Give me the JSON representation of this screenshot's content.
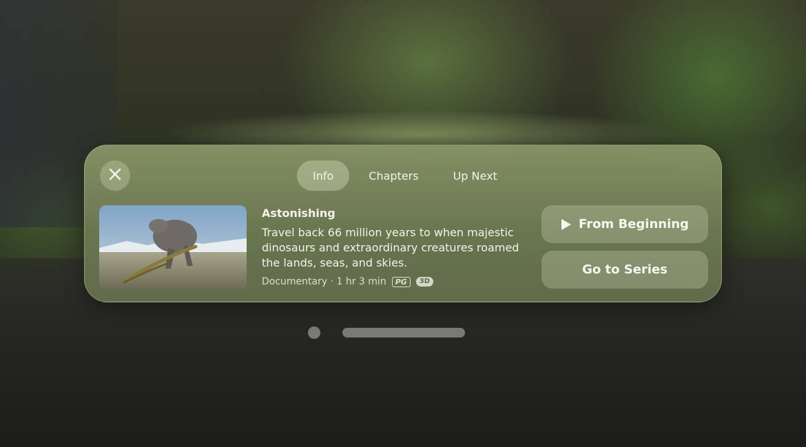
{
  "panel": {
    "tabs": [
      {
        "label": "Info",
        "active": true
      },
      {
        "label": "Chapters",
        "active": false
      },
      {
        "label": "Up Next",
        "active": false
      }
    ],
    "episode": {
      "title": "Astonishing",
      "description": "Travel back 66 million years to when majestic dinosaurs and extraordinary creatures roamed the lands, seas, and skies.",
      "genre_duration": "Documentary · 1 hr 3 min",
      "rating_badge": "PG",
      "format_badge": "3D"
    },
    "buttons": {
      "from_beginning": "From Beginning",
      "go_to_series": "Go to Series"
    }
  },
  "icons": {
    "close": "close-icon",
    "play": "play-icon"
  },
  "colors": {
    "panel_tint": "#7a875c",
    "text": "#f2f4ea"
  }
}
